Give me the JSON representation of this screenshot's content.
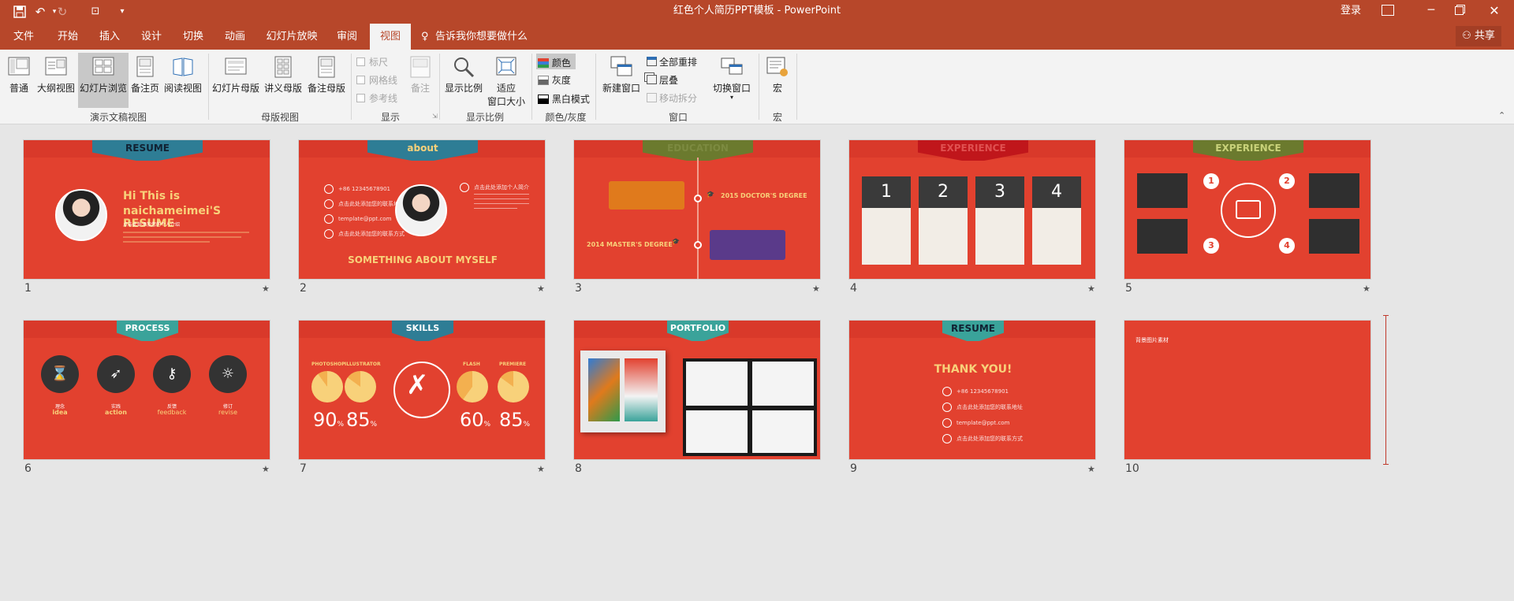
{
  "window": {
    "title": "红色个人简历PPT模板 - PowerPoint",
    "signin": "登录",
    "share": "共享",
    "tell_me": "告诉我你想要做什么"
  },
  "tabs": [
    "文件",
    "开始",
    "插入",
    "设计",
    "切换",
    "动画",
    "幻灯片放映",
    "审阅",
    "视图"
  ],
  "active_tab": "视图",
  "ribbon": {
    "presentation_views": {
      "label": "演示文稿视图",
      "buttons": [
        "普通",
        "大纲视图",
        "幻灯片浏览",
        "备注页",
        "阅读视图"
      ],
      "selected": "幻灯片浏览"
    },
    "master_views": {
      "label": "母版视图",
      "buttons": [
        "幻灯片母版",
        "讲义母版",
        "备注母版"
      ]
    },
    "show": {
      "label": "显示",
      "checks": [
        "标尺",
        "网格线",
        "参考线"
      ],
      "notes": "备注"
    },
    "zoom": {
      "label": "显示比例",
      "zoom": "显示比例",
      "fit": "适应",
      "fit2": "窗口大小"
    },
    "color": {
      "label": "颜色/灰度",
      "items": [
        "颜色",
        "灰度",
        "黑白模式"
      ],
      "selected": "颜色"
    },
    "window": {
      "label": "窗口",
      "new_window": "新建窗口",
      "arrange_all": "全部重排",
      "cascade": "层叠",
      "move_split": "移动拆分",
      "switch": "切换窗口"
    },
    "macros": {
      "label": "宏",
      "button": "宏"
    }
  },
  "slides": [
    {
      "num": "1",
      "header": "RESUME",
      "headline": "Hi This is",
      "headline2": "naichameimei'S RESUME",
      "sub": "点击此处添加您的个人介绍"
    },
    {
      "num": "2",
      "header": "about",
      "contact": [
        "+86 12345678901",
        "点击此处添加您的联系地址",
        "template@ppt.com",
        "点击此处添加您的联系方式"
      ],
      "intro": "点击此处添加个人简介",
      "footer": "SOMETHING ABOUT MYSELF"
    },
    {
      "num": "3",
      "header": "EDUCATION",
      "degree1": "2015 DOCTOR'S DEGREE",
      "degree2": "2014 MASTER'S DEGREE"
    },
    {
      "num": "4",
      "header": "EXPERIENCE",
      "cards": [
        "1",
        "2",
        "3",
        "4"
      ]
    },
    {
      "num": "5",
      "header": "EXPERIENCE",
      "nums": [
        "1",
        "2",
        "3",
        "4"
      ]
    },
    {
      "num": "6",
      "header": "PROCESS",
      "steps": [
        {
          "cn": "理念",
          "en": "idea"
        },
        {
          "cn": "实践",
          "en": "action"
        },
        {
          "cn": "反馈",
          "en": "feedback"
        },
        {
          "cn": "修订",
          "en": "revise"
        }
      ]
    },
    {
      "num": "7",
      "header": "SKILLS",
      "skills": [
        {
          "name": "PHOTOSHOP",
          "value": "90"
        },
        {
          "name": "ILLUSTRATOR",
          "value": "85"
        },
        {
          "name": "FLASH",
          "value": "60"
        },
        {
          "name": "PREMIERE",
          "value": "85"
        }
      ],
      "unit": "%"
    },
    {
      "num": "8",
      "header": "PORTFOLIO"
    },
    {
      "num": "9",
      "header": "RESUME",
      "headline": "THANK YOU!",
      "contact": [
        "+86 12345678901",
        "点击此处添加您的联系地址",
        "template@ppt.com",
        "点击此处添加您的联系方式"
      ]
    },
    {
      "num": "10",
      "note": "背景图片素材"
    }
  ],
  "star": "★",
  "colors": {
    "accent": "#b7472a",
    "slide_red": "#e2412f",
    "teal": "#3aa39a",
    "blue_ribbon": "#2e7d95",
    "olive": "#6b7a2e",
    "dark_red": "#c0161b"
  }
}
